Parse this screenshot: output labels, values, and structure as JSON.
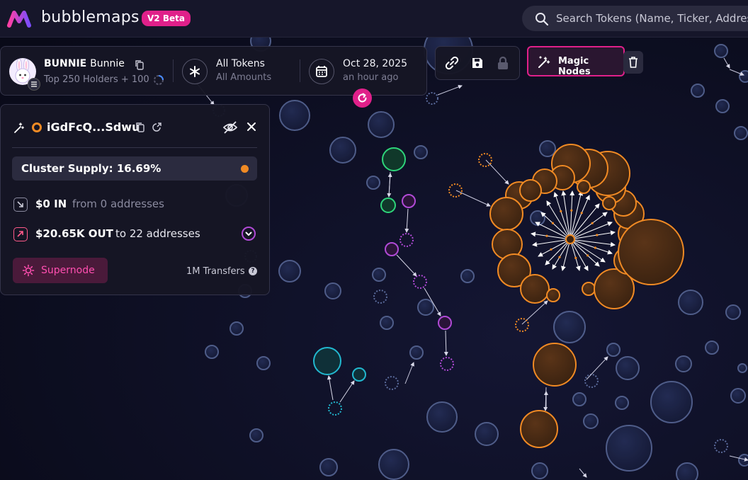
{
  "app": {
    "brand": "bubblemaps",
    "badge": "V2 Beta",
    "search_placeholder": "Search Tokens (Name, Ticker, Address)"
  },
  "token": {
    "symbol": "BUNNIE",
    "name": "Bunnie",
    "holders_label": "Top 250 Holders + 100"
  },
  "filters": {
    "tokens_title": "All Tokens",
    "tokens_sub": "All Amounts",
    "date_title": "Oct 28, 2025",
    "date_sub": "an hour ago"
  },
  "toolbar": {
    "magic_nodes_label": "Magic Nodes"
  },
  "wallet": {
    "address": "iGdFcQ...Sdwu",
    "cluster_supply": "Cluster Supply: 16.69%",
    "in_value": "$0 IN",
    "in_sub": "from 0 addresses",
    "out_value": "$20.65K OUT",
    "out_sub": "to 22 addresses",
    "supernode_label": "Supernode",
    "transfers_label": "1M Transfers"
  },
  "colors": {
    "accent": "#e0208a",
    "cluster_orange": "#f08a24",
    "node_purple": "#b14ad6",
    "node_green": "#2ed47a",
    "node_cyan": "#22b8cf",
    "bubble_blue": "#5a6a9a"
  }
}
